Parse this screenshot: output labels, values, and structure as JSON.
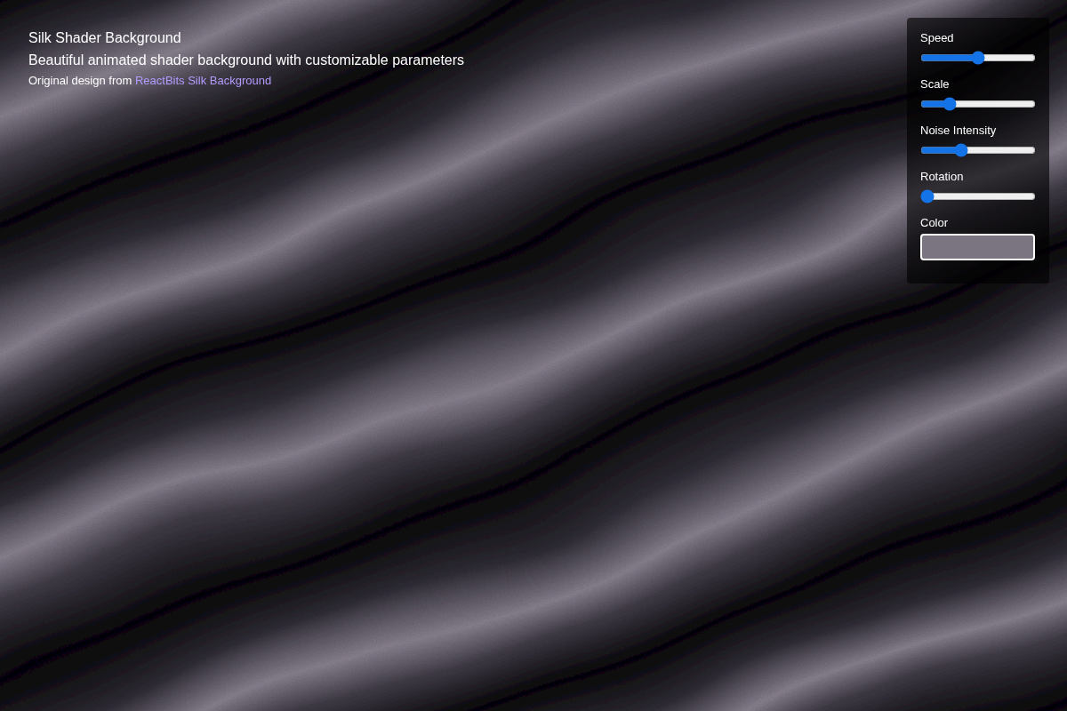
{
  "header": {
    "title": "Silk Shader Background",
    "subtitle": "Beautiful animated shader background with customizable parameters",
    "credit": "Original design from ",
    "link": "ReactBits Silk Background"
  },
  "controls": [
    {
      "label": "Speed",
      "kind": "slider",
      "level": 0.5
    },
    {
      "label": "Scale",
      "kind": "slider",
      "level": 0.22
    },
    {
      "label": "Noise Intensity",
      "kind": "slider",
      "level": 0.33
    },
    {
      "label": "Rotation",
      "kind": "slider",
      "level": 0
    },
    {
      "label": "Color",
      "kind": "color",
      "color": "#7b7481"
    }
  ]
}
